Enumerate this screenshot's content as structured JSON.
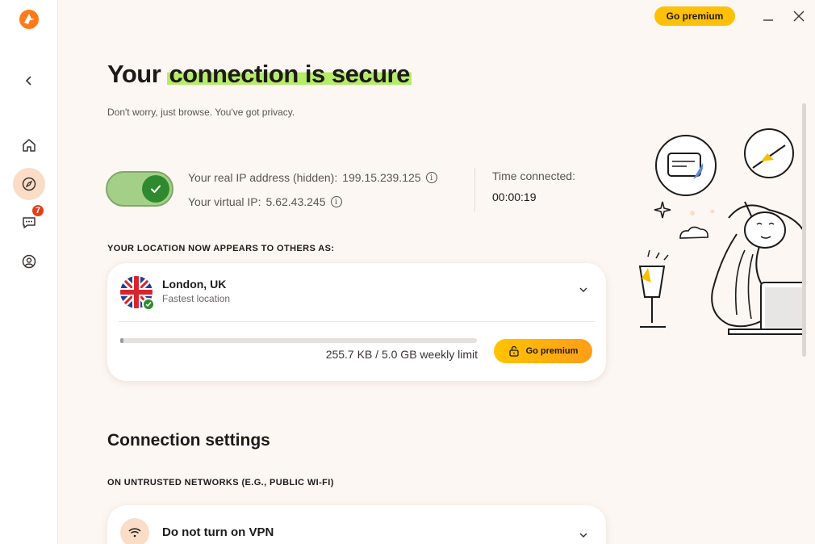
{
  "topbar": {
    "premium_label": "Go premium"
  },
  "header": {
    "title_plain": "Your",
    "title_highlight": "connection is secure",
    "subtitle": "Don't worry, just browse. You've got privacy."
  },
  "status": {
    "real_ip_label": "Your real IP address (hidden):",
    "real_ip": "199.15.239.125",
    "virtual_ip_label": "Your virtual IP:",
    "virtual_ip": "5.62.43.245",
    "time_label": "Time connected:",
    "time_value": "00:00:19",
    "vpn_on": true
  },
  "location": {
    "section_label": "YOUR LOCATION NOW APPEARS TO OTHERS AS:",
    "name": "London, UK",
    "sub": "Fastest location",
    "usage_text": "255.7 KB / 5.0 GB weekly limit",
    "usage_fraction": 0.01,
    "premium_label": "Go premium"
  },
  "settings": {
    "title": "Connection settings",
    "untrusted_label": "ON UNTRUSTED NETWORKS (E.G., PUBLIC WI-FI)",
    "untrusted_value": "Do not turn on VPN"
  },
  "sidebar": {
    "messages_badge": "7"
  },
  "colors": {
    "accent": "#ff7a1a",
    "highlight": "#b6eb6a",
    "success": "#2f8a2f",
    "premium": "#ffc107"
  }
}
